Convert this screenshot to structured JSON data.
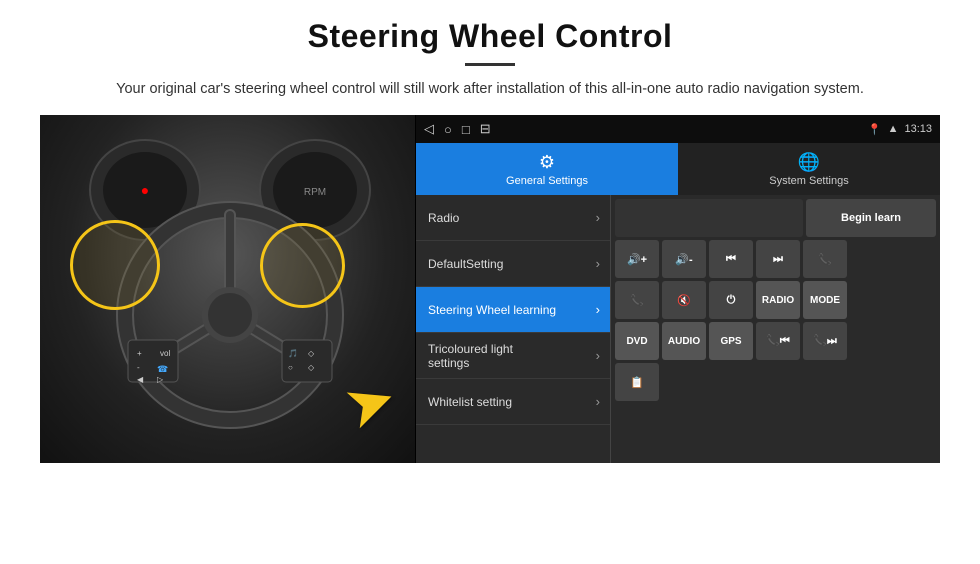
{
  "header": {
    "title": "Steering Wheel Control",
    "subtitle": "Your original car's steering wheel control will still work after installation of this all-in-one auto radio navigation system."
  },
  "status_bar": {
    "time": "13:13",
    "nav_icons": [
      "◁",
      "○",
      "□",
      "⊟"
    ]
  },
  "tabs": [
    {
      "id": "general",
      "label": "General Settings",
      "icon": "⚙",
      "active": true
    },
    {
      "id": "system",
      "label": "System Settings",
      "icon": "🌐",
      "active": false
    }
  ],
  "menu_items": [
    {
      "label": "Radio",
      "active": false
    },
    {
      "label": "DefaultSetting",
      "active": false
    },
    {
      "label": "Steering Wheel learning",
      "active": true
    },
    {
      "label": "Tricoloured light settings",
      "active": false
    },
    {
      "label": "Whitelist setting",
      "active": false
    }
  ],
  "control": {
    "begin_learn_label": "Begin learn",
    "rows": [
      {
        "cells": [
          "",
          "Begin learn"
        ]
      },
      {
        "cells": [
          "🔊+",
          "🔊-",
          "⏮",
          "⏭",
          "📞"
        ]
      },
      {
        "cells": [
          "📞",
          "🔇",
          "⏻",
          "RADIO",
          "MODE"
        ]
      },
      {
        "cells": [
          "DVD",
          "AUDIO",
          "GPS",
          "📞⏮",
          "📞⏭"
        ]
      },
      {
        "cells": [
          "📋"
        ]
      }
    ]
  }
}
